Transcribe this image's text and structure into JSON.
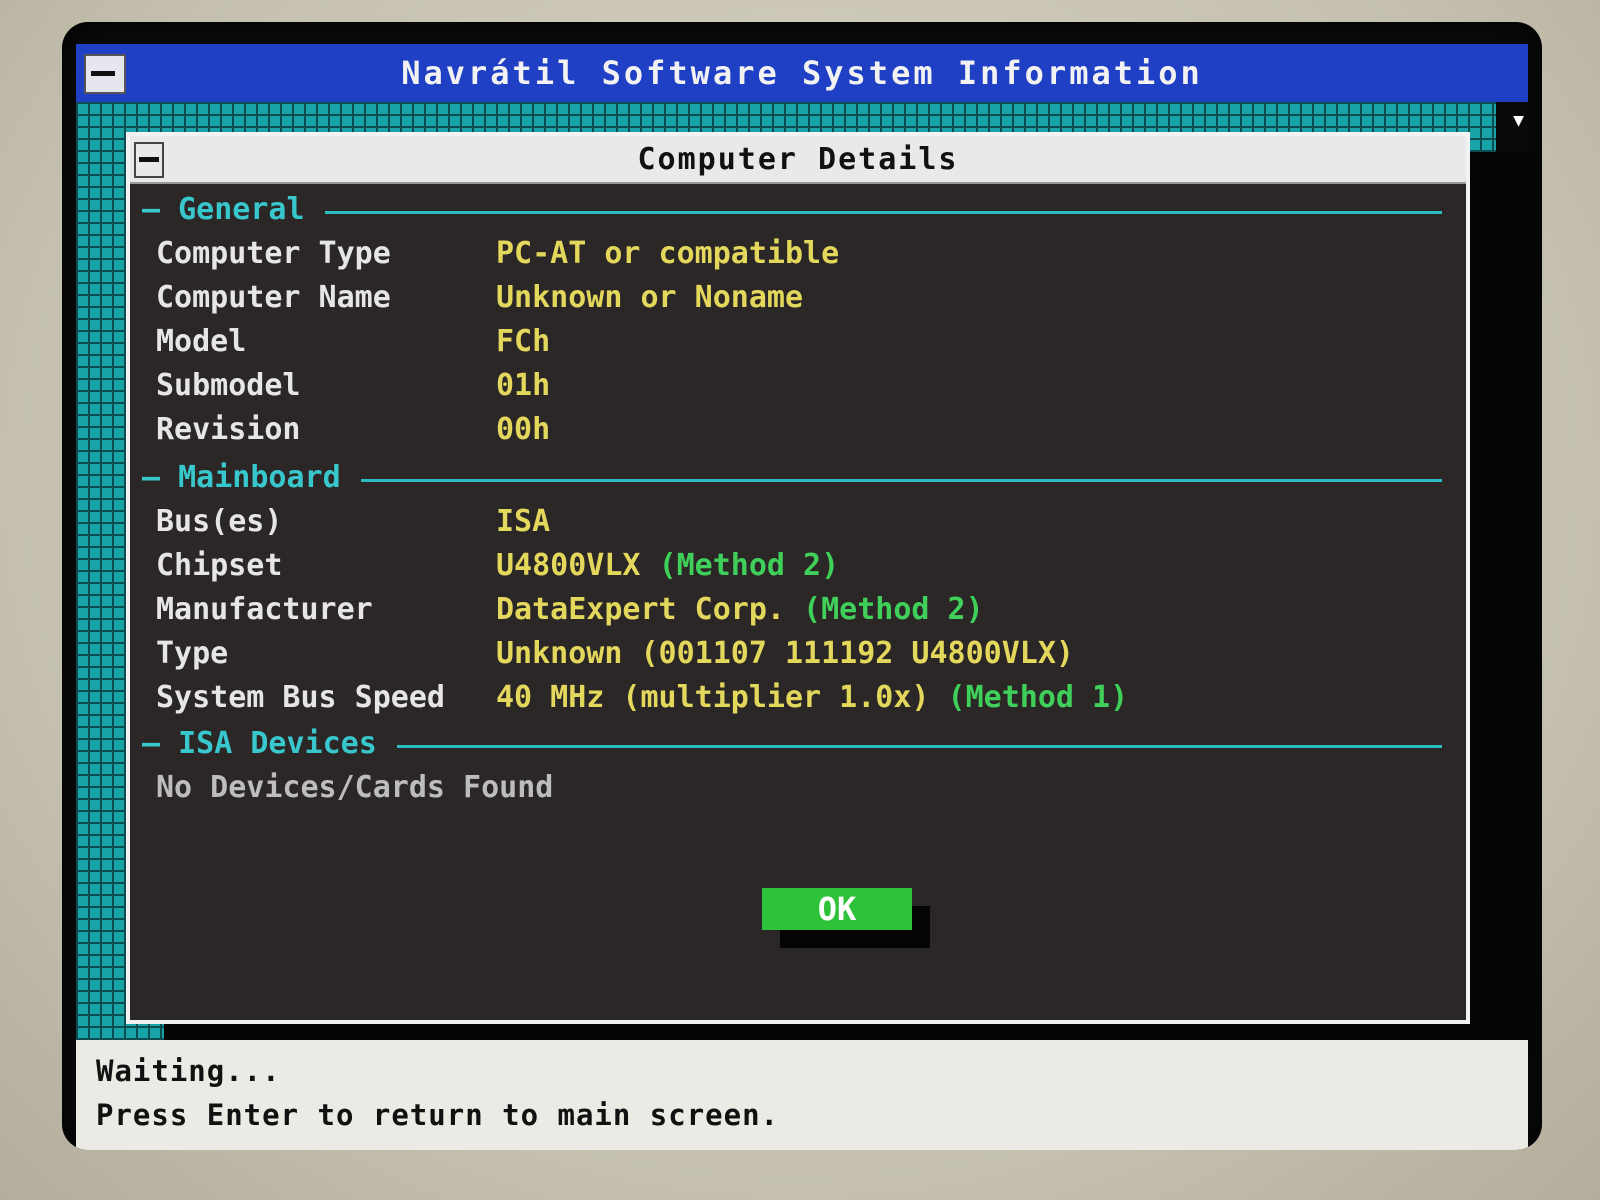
{
  "window": {
    "title": "Navrátil Software System Information"
  },
  "dialog": {
    "title": "Computer Details",
    "sections": {
      "general": {
        "label": "General",
        "rows": [
          {
            "label": "Computer Type",
            "value": "PC-AT or compatible"
          },
          {
            "label": "Computer Name",
            "value": "Unknown or Noname"
          },
          {
            "label": "Model",
            "value": "FCh"
          },
          {
            "label": "Submodel",
            "value": "01h"
          },
          {
            "label": "Revision",
            "value": "00h"
          }
        ]
      },
      "mainboard": {
        "label": "Mainboard",
        "rows": [
          {
            "label": "Bus(es)",
            "value": "ISA",
            "method": ""
          },
          {
            "label": "Chipset",
            "value": "U4800VLX",
            "method": "(Method 2)"
          },
          {
            "label": "Manufacturer",
            "value": "DataExpert Corp.",
            "method": "(Method 2)"
          },
          {
            "label": "Type",
            "value": "Unknown (001107 111192 U4800VLX)",
            "method": ""
          },
          {
            "label": "System Bus Speed",
            "value": "40 MHz (multiplier 1.0x)",
            "method": "(Method 1)"
          }
        ]
      },
      "isa": {
        "label": "ISA Devices",
        "empty_text": "No Devices/Cards Found"
      }
    },
    "ok_label": "OK"
  },
  "status": {
    "line1": "Waiting...",
    "line2": "Press Enter to return to main screen."
  },
  "colors": {
    "title_bar": "#1f3fc4",
    "desktop": "#1aa3a6",
    "dialog_bg": "#2c2727",
    "section_label": "#38c7cc",
    "value_text": "#e3d85c",
    "method_text": "#3fd05a",
    "ok_button": "#2ec23a"
  },
  "icons": {
    "window_menu": "system-menu-icon",
    "scroll": "down-arrow-icon"
  }
}
